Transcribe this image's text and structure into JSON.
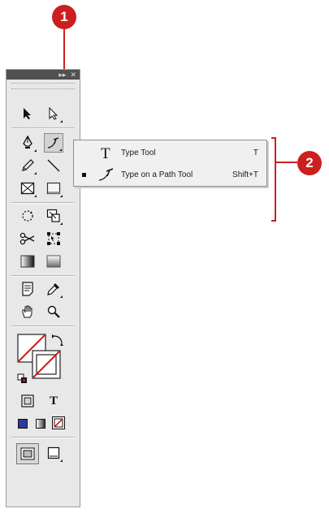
{
  "callouts": {
    "one": "1",
    "two": "2"
  },
  "panel": {
    "title_buttons": [
      "▸▸",
      "✕"
    ]
  },
  "flyout": {
    "items": [
      {
        "label": "Type Tool",
        "shortcut": "T",
        "icon": "type-icon",
        "selected": false
      },
      {
        "label": "Type on a Path Tool",
        "shortcut": "Shift+T",
        "icon": "type-on-path-icon",
        "selected": true
      }
    ]
  },
  "tools": {
    "type_label": "T",
    "colors": {
      "accent": "#cc1f1f",
      "fill_swatch": "#2b3a9a",
      "none_stroke": "#cc1f1f"
    }
  }
}
